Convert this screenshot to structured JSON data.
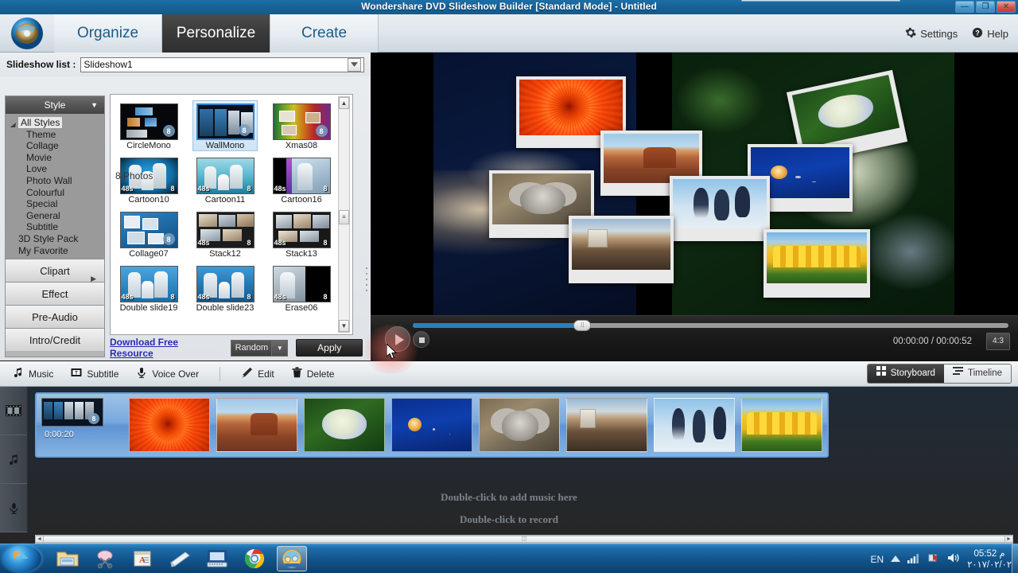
{
  "window": {
    "title": "Wondershare DVD Slideshow Builder [Standard Mode] - Untitled",
    "minimize_label": "—",
    "maximize_label": "❐",
    "close_label": "✕"
  },
  "ribbon": {
    "tabs": [
      {
        "label": "Organize",
        "active": false
      },
      {
        "label": "Personalize",
        "active": true
      },
      {
        "label": "Create",
        "active": false
      }
    ],
    "settings_label": "Settings",
    "help_label": "Help"
  },
  "slideshow_list": {
    "label": "Slideshow list :",
    "value": "Slideshow1",
    "dropdown_icon": "chevron-down-icon"
  },
  "style_panel": {
    "accordion_title": "Style",
    "tree": [
      {
        "label": "All Styles",
        "level": 0,
        "selected": true,
        "twisty": "◢"
      },
      {
        "label": "Theme",
        "level": 1,
        "selected": false
      },
      {
        "label": "Collage",
        "level": 1,
        "selected": false
      },
      {
        "label": "Movie",
        "level": 1,
        "selected": false
      },
      {
        "label": "Love",
        "level": 1,
        "selected": false
      },
      {
        "label": "Photo Wall",
        "level": 1,
        "selected": false
      },
      {
        "label": "Colourful",
        "level": 1,
        "selected": false
      },
      {
        "label": "Special",
        "level": 1,
        "selected": false
      },
      {
        "label": "General",
        "level": 1,
        "selected": false
      },
      {
        "label": "Subtitle",
        "level": 1,
        "selected": false
      },
      {
        "label": "3D Style Pack",
        "level": 0,
        "selected": false
      },
      {
        "label": "My Favorite",
        "level": 0,
        "selected": false
      }
    ],
    "buttons": [
      {
        "label": "Clipart",
        "has_submenu": true
      },
      {
        "label": "Effect",
        "has_submenu": false
      },
      {
        "label": "Pre-Audio",
        "has_submenu": false
      },
      {
        "label": "Intro/Credit",
        "has_submenu": false
      }
    ],
    "photos_count": "8 Photos",
    "styles": [
      {
        "name": "CircleMono",
        "badge": "8",
        "duration": "",
        "selected": false,
        "theme": "circlemono"
      },
      {
        "name": "WallMono",
        "badge": "8",
        "duration": "",
        "selected": true,
        "theme": "wallmono"
      },
      {
        "name": "Xmas08",
        "badge": "8",
        "duration": "",
        "selected": false,
        "theme": "xmas"
      },
      {
        "name": "Cartoon10",
        "badge": "",
        "duration": "48s",
        "count": "8",
        "selected": false,
        "theme": "cartoon10"
      },
      {
        "name": "Cartoon11",
        "badge": "",
        "duration": "48s",
        "count": "8",
        "selected": false,
        "theme": "cartoon11"
      },
      {
        "name": "Cartoon16",
        "badge": "",
        "duration": "48s",
        "count": "8",
        "selected": false,
        "theme": "cartoon16"
      },
      {
        "name": "Collage07",
        "badge": "8",
        "duration": "",
        "selected": false,
        "theme": "collage07"
      },
      {
        "name": "Stack12",
        "badge": "",
        "duration": "48s",
        "count": "8",
        "selected": false,
        "theme": "stack12"
      },
      {
        "name": "Stack13",
        "badge": "",
        "duration": "48s",
        "count": "8",
        "selected": false,
        "theme": "stack13"
      },
      {
        "name": "Double slide19",
        "badge": "",
        "duration": "48s",
        "count": "8",
        "selected": false,
        "theme": "ds19"
      },
      {
        "name": "Double slide23",
        "badge": "",
        "duration": "48s",
        "count": "8",
        "selected": false,
        "theme": "ds23"
      },
      {
        "name": "Erase06",
        "badge": "",
        "duration": "48s",
        "count": "8",
        "selected": false,
        "theme": "erase06"
      }
    ],
    "download_link": "Download Free Resource",
    "transition_value": "Random",
    "apply_label": "Apply"
  },
  "player": {
    "current_time": "00:00:00",
    "separator": "/",
    "total_time": "00:00:52",
    "timecode": "00:00:00 / 00:00:52",
    "aspect_ratio": "4:3",
    "play_icon": "play-icon",
    "stop_icon": "stop-icon",
    "progress_percent": 28
  },
  "toolbar": {
    "items": [
      {
        "label": "Music",
        "icon": "music-note-icon"
      },
      {
        "label": "Subtitle",
        "icon": "subtitle-icon"
      },
      {
        "label": "Voice Over",
        "icon": "microphone-icon"
      },
      {
        "label": "Edit",
        "icon": "pencil-icon"
      },
      {
        "label": "Delete",
        "icon": "trash-icon"
      }
    ],
    "views": [
      {
        "label": "Storyboard",
        "icon": "grid-icon",
        "active": true
      },
      {
        "label": "Timeline",
        "icon": "timeline-icon",
        "active": false
      }
    ]
  },
  "storyboard": {
    "tracks": [
      {
        "icon": "film-strip-icon",
        "name": "video-track"
      },
      {
        "icon": "music-note-icon",
        "name": "music-track"
      },
      {
        "icon": "microphone-icon",
        "name": "voice-track"
      }
    ],
    "clips": [
      {
        "theme": "intro",
        "duration": "0:00:20",
        "badge": "8"
      },
      {
        "theme": "flower",
        "duration": ""
      },
      {
        "theme": "canyon",
        "duration": ""
      },
      {
        "theme": "hydrangea",
        "duration": ""
      },
      {
        "theme": "jelly",
        "duration": ""
      },
      {
        "theme": "koala",
        "duration": ""
      },
      {
        "theme": "castle",
        "duration": ""
      },
      {
        "theme": "penguin",
        "duration": ""
      },
      {
        "theme": "tulip",
        "duration": ""
      }
    ],
    "music_hint": "Double-click to add music here",
    "record_hint": "Double-click to record"
  },
  "taskbar": {
    "start_label": "Start",
    "apps": [
      {
        "name": "explorer",
        "active": false
      },
      {
        "name": "snipping-tool",
        "active": false
      },
      {
        "name": "document-app",
        "active": false
      },
      {
        "name": "sticky-notes",
        "active": false
      },
      {
        "name": "remote-desktop",
        "active": false
      },
      {
        "name": "chrome",
        "active": false
      },
      {
        "name": "dvd-slideshow-builder",
        "active": true
      }
    ],
    "language": "EN",
    "time": "05:52 م",
    "date": "٢٠١٧/٠٢/٠٢",
    "tray_icons": [
      "show-hidden-icon",
      "network-icon",
      "action-center-icon",
      "volume-icon"
    ]
  }
}
